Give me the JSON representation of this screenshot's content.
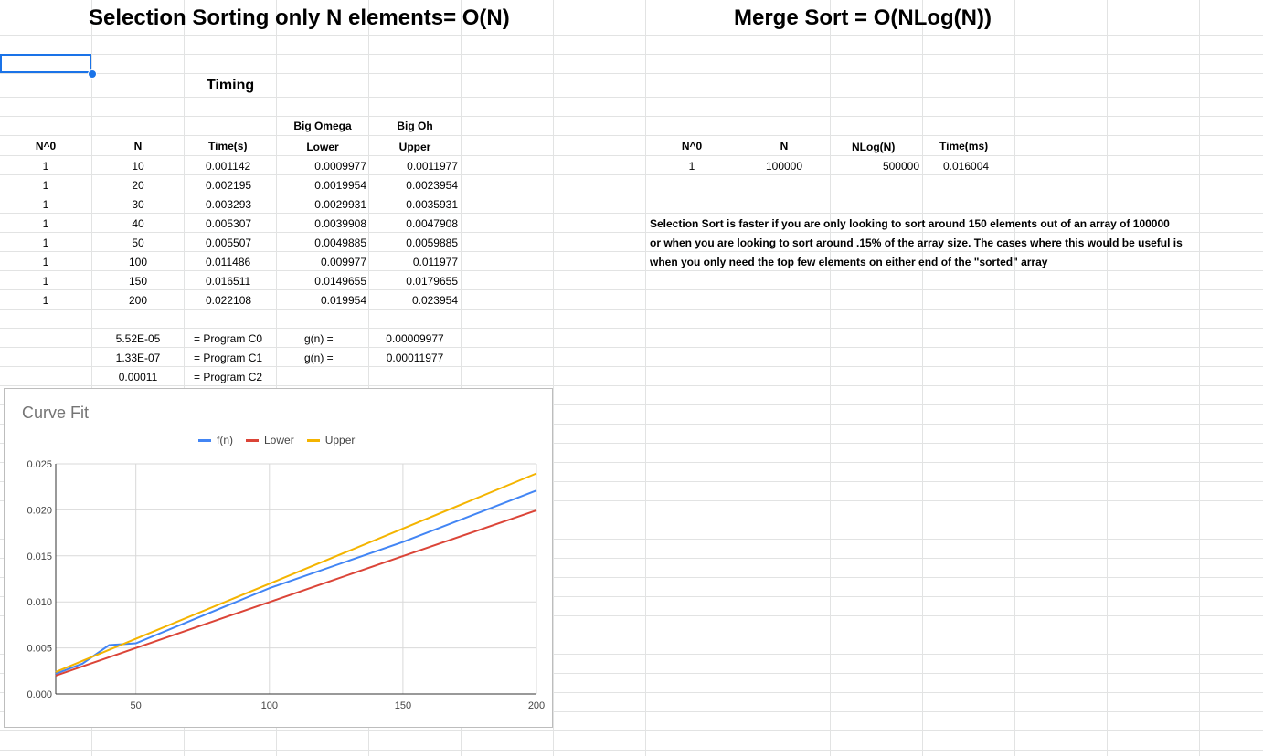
{
  "sheet": {
    "title_left": "Selection Sorting only N elements= O(N)",
    "title_right": "Merge Sort = O(NLog(N))",
    "timing_label": "Timing",
    "headers_top": {
      "big_omega": "Big Omega",
      "big_oh": "Big Oh"
    },
    "headers": {
      "n0": "N^0",
      "n": "N",
      "time": "Time(s)",
      "lower": "Lower",
      "upper": "Upper"
    },
    "rows": [
      {
        "n0": "1",
        "n": "10",
        "time": "0.001142",
        "lower": "0.0009977",
        "upper": "0.0011977"
      },
      {
        "n0": "1",
        "n": "20",
        "time": "0.002195",
        "lower": "0.0019954",
        "upper": "0.0023954"
      },
      {
        "n0": "1",
        "n": "30",
        "time": "0.003293",
        "lower": "0.0029931",
        "upper": "0.0035931"
      },
      {
        "n0": "1",
        "n": "40",
        "time": "0.005307",
        "lower": "0.0039908",
        "upper": "0.0047908"
      },
      {
        "n0": "1",
        "n": "50",
        "time": "0.005507",
        "lower": "0.0049885",
        "upper": "0.0059885"
      },
      {
        "n0": "1",
        "n": "100",
        "time": "0.011486",
        "lower": "0.009977",
        "upper": "0.011977"
      },
      {
        "n0": "1",
        "n": "150",
        "time": "0.016511",
        "lower": "0.0149655",
        "upper": "0.0179655"
      },
      {
        "n0": "1",
        "n": "200",
        "time": "0.022108",
        "lower": "0.019954",
        "upper": "0.023954"
      }
    ],
    "coeffs": [
      {
        "value": "5.52E-05",
        "label": "= Program C0",
        "g": "g(n) =",
        "gval": "0.00009977"
      },
      {
        "value": "1.33E-07",
        "label": "= Program C1",
        "g": "g(n) =",
        "gval": "0.00011977"
      },
      {
        "value": "0.00011",
        "label": "= Program C2",
        "g": "",
        "gval": ""
      }
    ],
    "merge": {
      "headers": {
        "n0": "N^0",
        "n": "N",
        "nlogn": "NLog(N)",
        "time": "Time(ms)"
      },
      "row": {
        "n0": "1",
        "n": "100000",
        "nlogn": "500000",
        "time": "0.016004"
      }
    },
    "notes": [
      "Selection Sort is faster if you are only looking to sort around 150 elements out of an array of 100000",
      "or when you are looking to sort around .15% of the array size. The cases where this would be useful is",
      "when you only need the top few elements on either end of the \"sorted\" array"
    ]
  },
  "colors": {
    "fn": "#4285f4",
    "lower": "#db4437",
    "upper": "#f4b400",
    "grid": "#e2e3e3",
    "selection": "#1a73e8"
  },
  "chart_data": {
    "type": "line",
    "title": "Curve Fit",
    "x": [
      10,
      20,
      30,
      40,
      50,
      100,
      150,
      200
    ],
    "series": [
      {
        "name": "f(n)",
        "values": [
          0.001142,
          0.002195,
          0.003293,
          0.005307,
          0.005507,
          0.011486,
          0.016511,
          0.022108
        ]
      },
      {
        "name": "Lower",
        "values": [
          0.0009977,
          0.0019954,
          0.0029931,
          0.0039908,
          0.0049885,
          0.009977,
          0.0149655,
          0.019954
        ]
      },
      {
        "name": "Upper",
        "values": [
          0.0011977,
          0.0023954,
          0.0035931,
          0.0047908,
          0.0059885,
          0.011977,
          0.0179655,
          0.023954
        ]
      }
    ],
    "xlim": [
      20,
      200
    ],
    "ylim": [
      0,
      0.025
    ],
    "x_ticks": [
      "50",
      "100",
      "150",
      "200"
    ],
    "y_ticks": [
      "0.000",
      "0.005",
      "0.010",
      "0.015",
      "0.020",
      "0.025"
    ],
    "legend_position": "top",
    "grid": true
  }
}
